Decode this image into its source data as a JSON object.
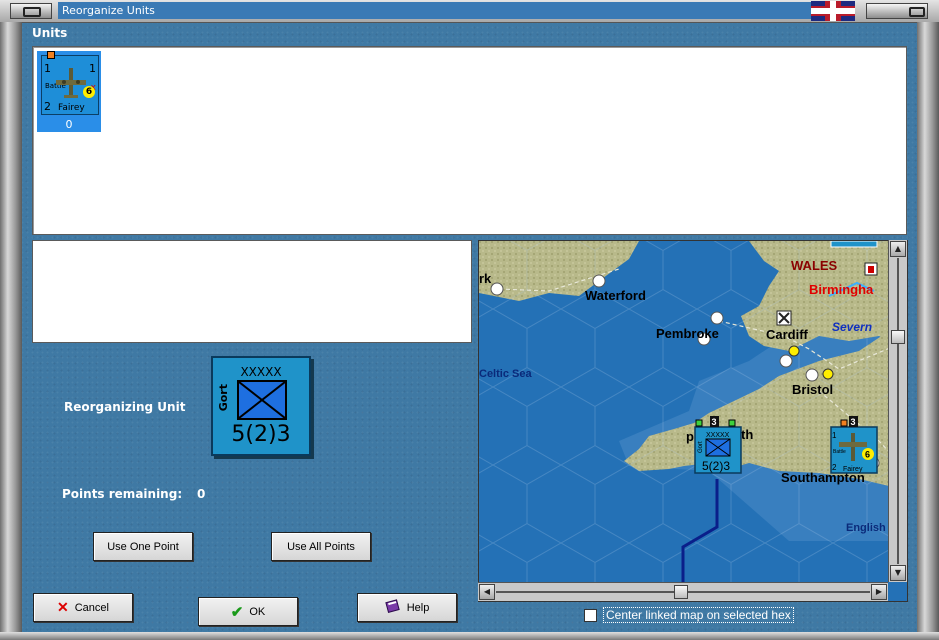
{
  "window": {
    "title": "Reorganize Units",
    "flag": "uk-flag"
  },
  "units": {
    "label": "Units",
    "items": [
      {
        "top_left": "1",
        "top_right": "1",
        "bottom_left": "2",
        "name": "Fairey",
        "type_label": "Battle",
        "coin": "6",
        "x_mark": "x",
        "below": "0"
      }
    ]
  },
  "reorg": {
    "label": "Reorganizing Unit",
    "counter": {
      "top": "XXXXX",
      "side": "Gort",
      "bottom": "5(2)3"
    },
    "points_label": "Points remaining:",
    "points_value": "0"
  },
  "buttons": {
    "use_one": "Use One Point",
    "use_all": "Use All Points",
    "cancel": "Cancel",
    "ok": "OK",
    "help": "Help"
  },
  "map": {
    "places": {
      "waterford": "Waterford",
      "pembroke": "Pembroke",
      "cardiff": "Cardiff",
      "bristol": "Bristol",
      "wales": "WALES",
      "birmingham": "Birmingha",
      "severn": "Severn",
      "celtic_sea": "Celtic Sea",
      "southampton": "Southampton",
      "english": "English",
      "york_part": "rk",
      "plymouth_a": "p",
      "plymouth_b": "th"
    },
    "counters": {
      "army": {
        "top": "XXXXX",
        "side": "Gort",
        "bottom": "5(2)3",
        "badge": "3"
      },
      "air": {
        "top_left": "1",
        "bottom_left": "2",
        "name": "Fairey",
        "type_label": "Battle",
        "coin": "6",
        "badge": "3"
      }
    }
  },
  "checkbox": {
    "label": "Center linked map on selected hex",
    "checked": false
  },
  "colors": {
    "background": "#3f79a4",
    "sea": "#2471b6",
    "land": "#b7b98a",
    "panel": "#ffffff",
    "counter": "#1f93c9"
  }
}
